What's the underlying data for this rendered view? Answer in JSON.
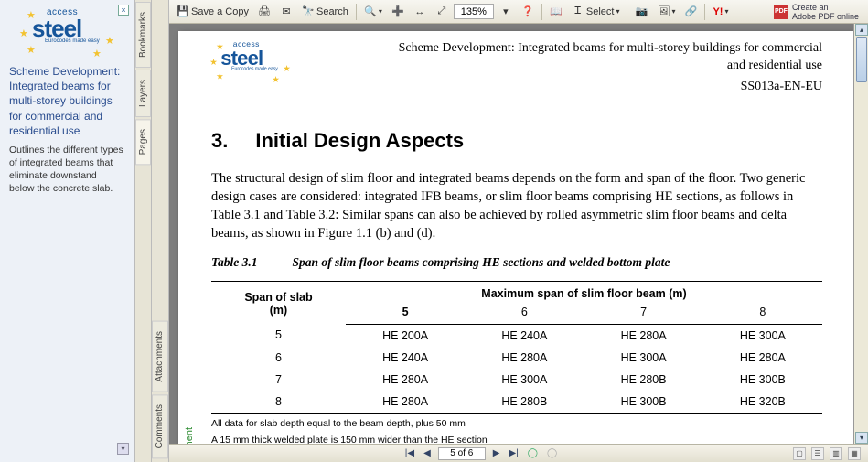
{
  "sidebar": {
    "title": "Scheme Development: Integrated beams for multi-storey buildings for commercial and residential use",
    "description": "Outlines the different types of integrated beams that eliminate downstand below the concrete slab."
  },
  "tabs": {
    "bookmarks": "Bookmarks",
    "layers": "Layers",
    "pages": "Pages",
    "attachments": "Attachments",
    "comments": "Comments"
  },
  "toolbar": {
    "saveacopy": "Save a Copy",
    "search": "Search",
    "zoom": "135%",
    "select": "Select",
    "createpdf_line1": "Create an",
    "createpdf_line2": "Adobe PDF online",
    "yahoo": "Y!"
  },
  "document": {
    "header_line1": "Scheme Development: Integrated beams for multi-storey buildings for commercial",
    "header_line2": "and residential use",
    "ref": "SS013a-EN-EU",
    "section_num": "3.",
    "section_title": "Initial Design Aspects",
    "para": "The structural design of slim floor and integrated beams depends on the form and span of the floor.  Two generic design cases are considered: integrated IFB beams, or slim floor beams comprising HE sections, as follows in Table 3.1 and Table 3.2:  Similar spans can also be achieved by rolled asymmetric slim floor beams and delta beams, as shown in Figure 1.1 (b) and (d).",
    "table_label": "Table 3.1",
    "table_caption": "Span of slim floor beams comprising HE sections and welded bottom plate",
    "col_head_left_1": "Span of slab",
    "col_head_left_2": "(m)",
    "col_head_right": "Maximum span of slim floor beam (m)",
    "subcols": [
      "5",
      "6",
      "7",
      "8"
    ],
    "rows": [
      {
        "span": "5",
        "c": [
          "HE 200A",
          "HE 240A",
          "HE 280A",
          "HE 300A"
        ]
      },
      {
        "span": "6",
        "c": [
          "HE 240A",
          "HE 280A",
          "HE 300A",
          "HE 280A"
        ]
      },
      {
        "span": "7",
        "c": [
          "HE 280A",
          "HE 300A",
          "HE 280B",
          "HE 300B"
        ]
      },
      {
        "span": "8",
        "c": [
          "HE 280A",
          "HE 280B",
          "HE 300B",
          "HE 320B"
        ]
      }
    ],
    "note1": "All data for slab depth equal to the beam depth, plus 50 mm",
    "note2": "A 15 mm thick welded plate is 150 mm wider than the HE section",
    "ement": "ement"
  },
  "status": {
    "page": "5 of 6"
  },
  "logo": {
    "access": "access",
    "steel": "steel",
    "tagline": "Eurocodes made easy"
  }
}
